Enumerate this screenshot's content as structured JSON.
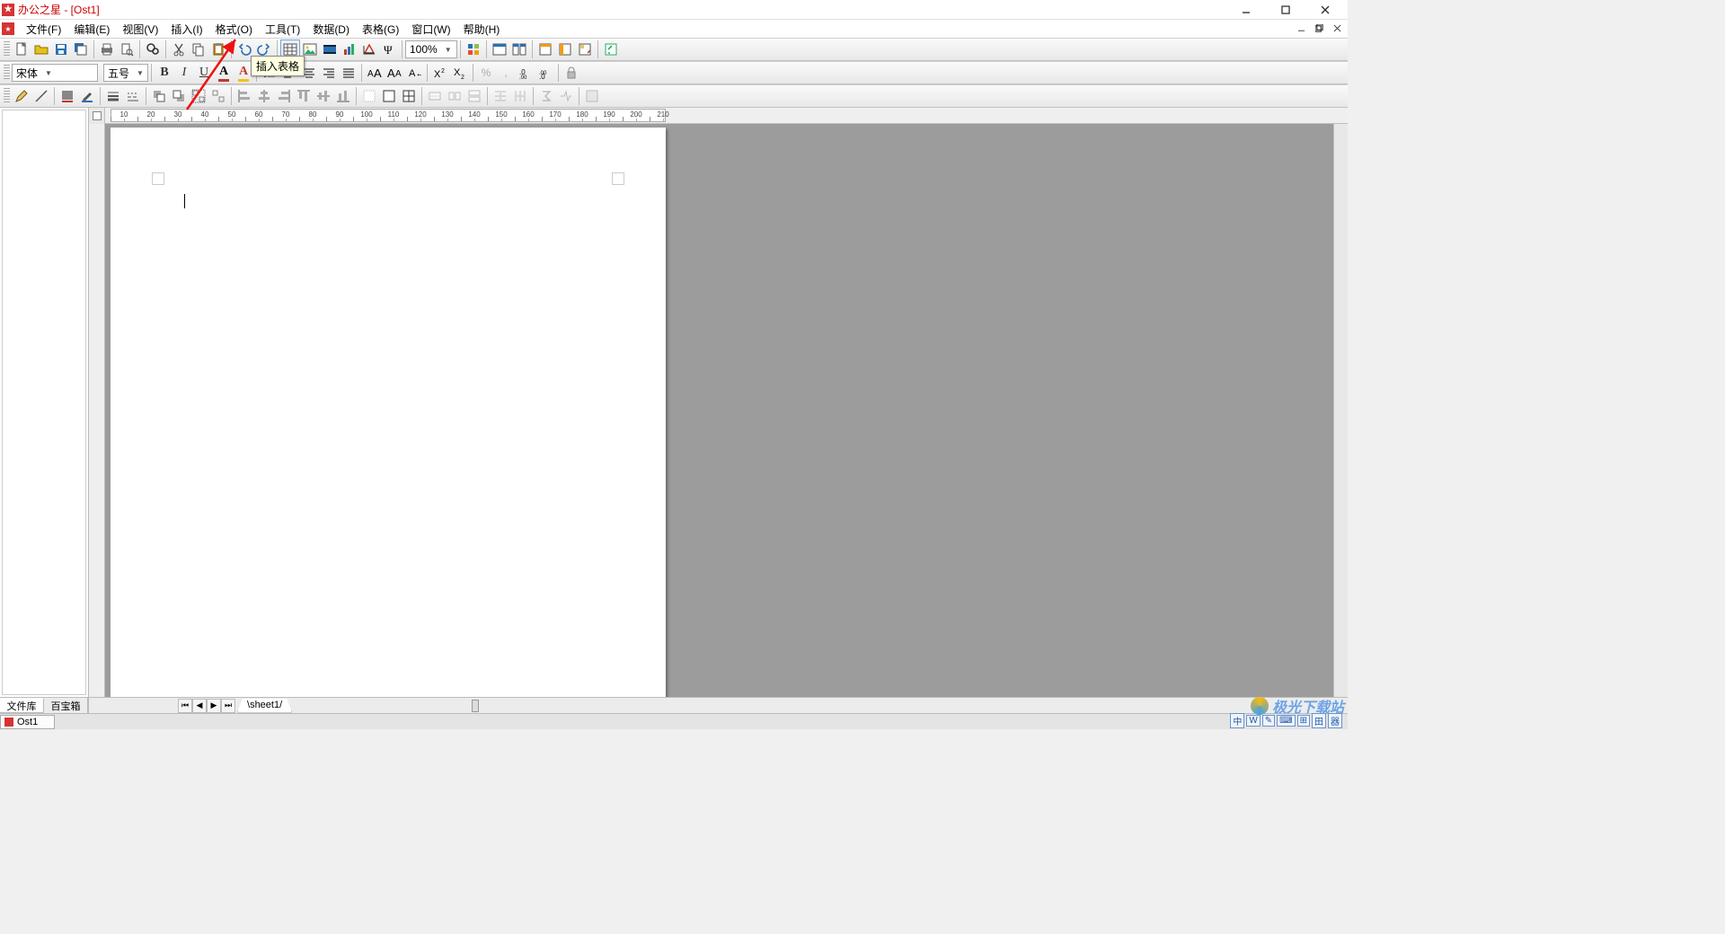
{
  "window": {
    "title": "办公之星 - [Ost1]"
  },
  "menu": {
    "items": [
      "文件(F)",
      "编辑(E)",
      "视图(V)",
      "插入(I)",
      "格式(O)",
      "工具(T)",
      "数据(D)",
      "表格(G)",
      "窗口(W)",
      "帮助(H)"
    ]
  },
  "toolbar1": {
    "zoom": "100%"
  },
  "toolbar2": {
    "font_name": "宋体",
    "font_size": "五号",
    "bold": "B",
    "italic": "I",
    "underline": "U",
    "font_color_letter": "A",
    "highlight_letter": "A"
  },
  "tooltip": {
    "insert_table": "插入表格"
  },
  "ruler": {
    "marks": [
      "10",
      "20",
      "30",
      "40",
      "50",
      "60",
      "70",
      "80",
      "90",
      "100",
      "110",
      "120",
      "130",
      "140",
      "150",
      "160",
      "170",
      "180",
      "190",
      "200",
      "210"
    ]
  },
  "side_panel": {
    "tabs": [
      "文件库",
      "百宝箱"
    ]
  },
  "sheet": {
    "name": "sheet1"
  },
  "window_tab": {
    "name": "Ost1"
  },
  "watermark": {
    "text": "极光下载站"
  },
  "ime": {
    "chips": [
      "中",
      "W",
      "✎",
      "⌨",
      "⊞",
      "田",
      "器"
    ]
  }
}
